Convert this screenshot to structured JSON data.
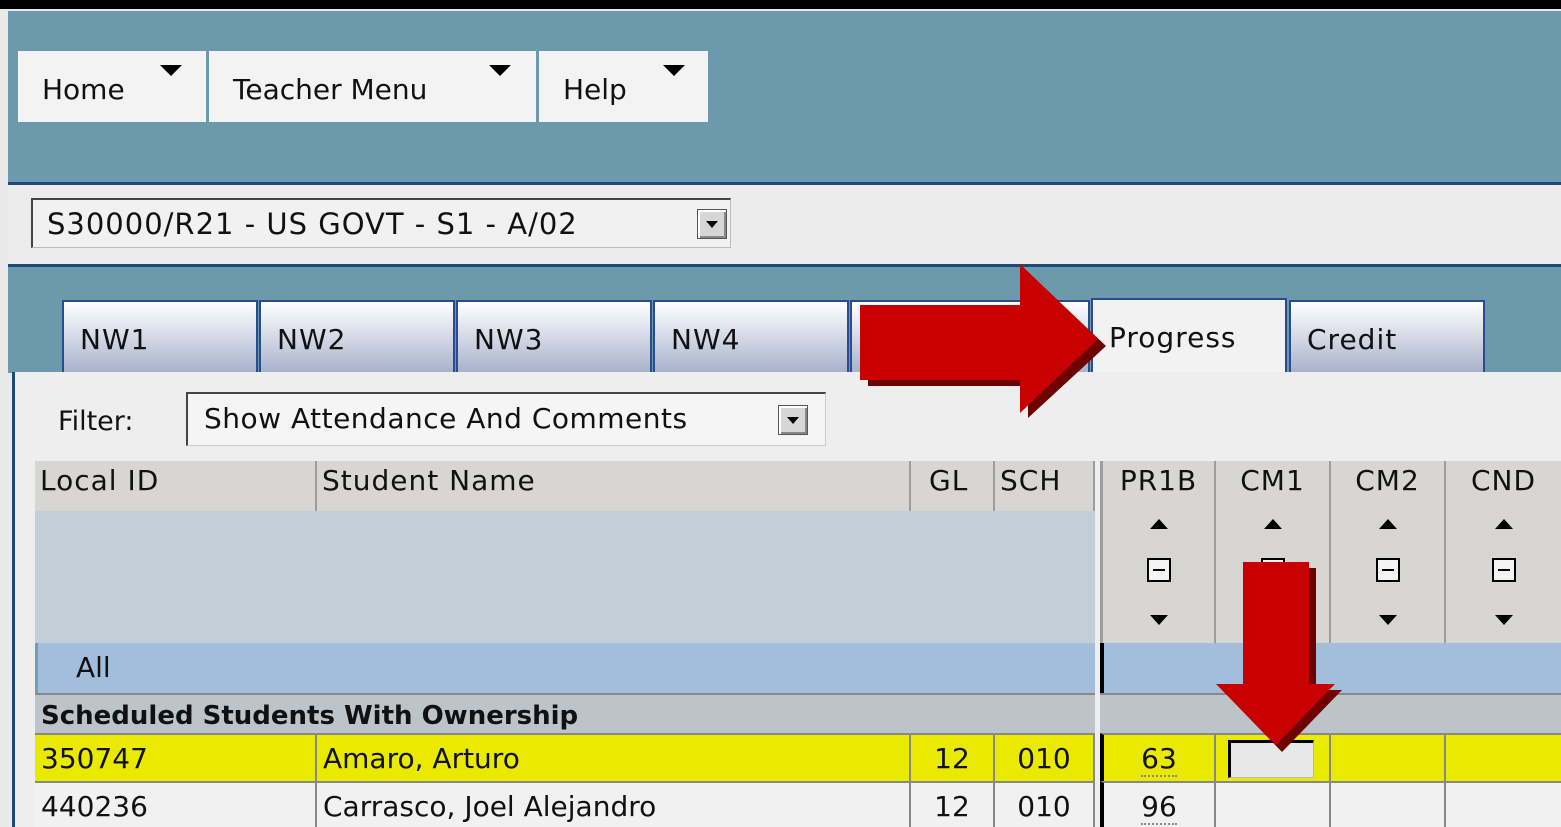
{
  "menu": {
    "items": [
      {
        "label": "Home"
      },
      {
        "label": "Teacher Menu"
      },
      {
        "label": "Help"
      }
    ]
  },
  "course": {
    "selected": "S30000/R21 - US GOVT - S1 - A/02"
  },
  "tabs": [
    {
      "label": "NW1"
    },
    {
      "label": "NW2"
    },
    {
      "label": "NW3"
    },
    {
      "label": "NW4"
    },
    {
      "label": ""
    },
    {
      "label": "Progress"
    },
    {
      "label": "Credit"
    }
  ],
  "filter": {
    "label": "Filter:",
    "selected": "Show Attendance And Comments"
  },
  "table": {
    "columns": {
      "local_id": "Local ID",
      "student_name": "Student Name",
      "gl": "GL",
      "sch": "SCH",
      "pr1b": "PR1B",
      "cm1": "CM1",
      "cm2": "CM2",
      "cnd": "CND"
    },
    "all_label": "All",
    "group_label": "Scheduled Students With Ownership",
    "rows": [
      {
        "local_id": "350747",
        "name": "Amaro, Arturo",
        "gl": "12",
        "sch": "010",
        "pr1b": "63",
        "cm1": "",
        "cm2": "",
        "cnd": ""
      },
      {
        "local_id": "440236",
        "name": "Carrasco, Joel Alejandro",
        "gl": "12",
        "sch": "010",
        "pr1b": "96",
        "cm1": "",
        "cm2": "",
        "cnd": ""
      }
    ]
  },
  "colors": {
    "menubar": "#6c9aac",
    "highlight_row": "#eaea00",
    "annotation_arrow": "#c80000",
    "tab_border": "#2a4b90"
  }
}
